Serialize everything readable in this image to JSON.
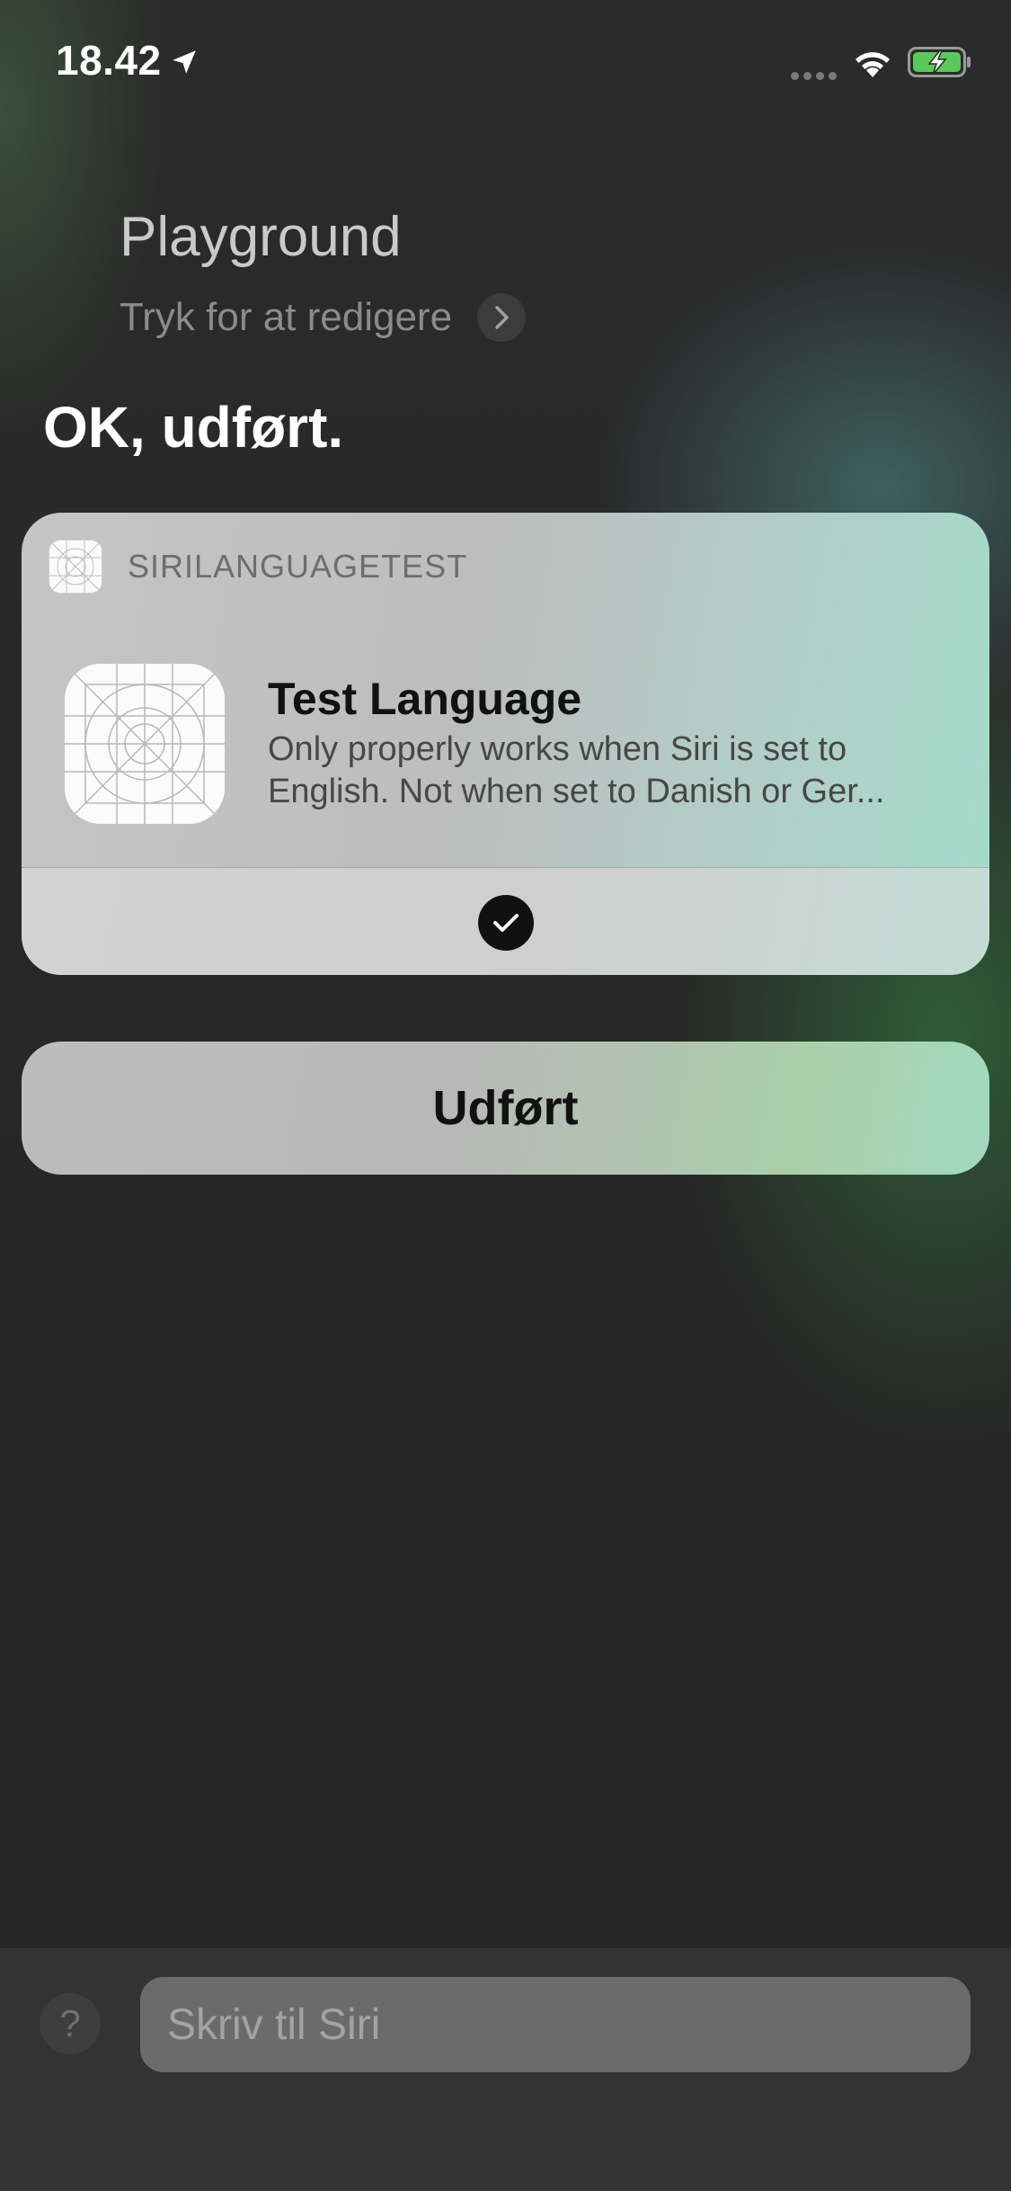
{
  "status_bar": {
    "time": "18.42",
    "icons": [
      "location-arrow-icon",
      "cellular-signal-icon",
      "wifi-icon",
      "battery-charging-icon"
    ],
    "battery_color": "#5ac85a"
  },
  "shortcut": {
    "name": "Playground",
    "edit_label": "Tryk for at redigere"
  },
  "siri_response": "OK, udført.",
  "card": {
    "app_name": "SIRILANGUAGETEST",
    "item_title": "Test Language",
    "item_description": "Only properly works when Siri is set to English. Not when set to Danish or Ger...",
    "status_icon": "checkmark-circle-icon"
  },
  "done_button_label": "Udført",
  "bottom_bar": {
    "help_label": "?",
    "input_placeholder": "Skriv til Siri"
  }
}
